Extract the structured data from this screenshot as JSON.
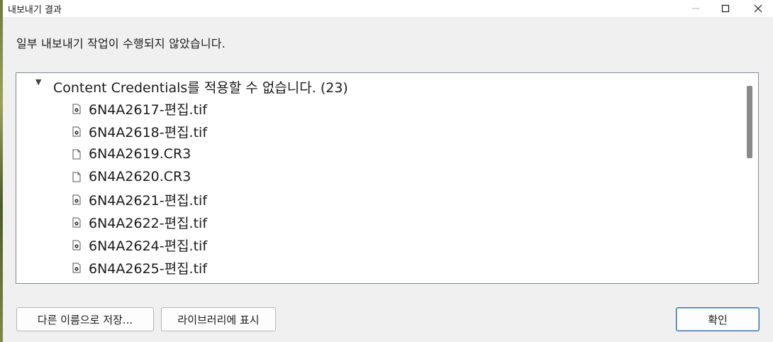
{
  "window": {
    "title": "내보내기 결과",
    "controls": {
      "minimize": "—",
      "maximize": "☐",
      "close": "✕"
    }
  },
  "message": "일부 내보내기 작업이 수행되지 않았습니다.",
  "results": {
    "group_label": "Content Credentials를 적용할 수 없습니다. (23)",
    "files": [
      {
        "name": "6N4A2617-편집.tif",
        "icon": "image-file-icon"
      },
      {
        "name": "6N4A2618-편집.tif",
        "icon": "image-file-icon"
      },
      {
        "name": "6N4A2619.CR3",
        "icon": "blank-file-icon"
      },
      {
        "name": "6N4A2620.CR3",
        "icon": "blank-file-icon"
      },
      {
        "name": "6N4A2621-편집.tif",
        "icon": "image-file-icon"
      },
      {
        "name": "6N4A2622-편집.tif",
        "icon": "image-file-icon"
      },
      {
        "name": "6N4A2624-편집.tif",
        "icon": "image-file-icon"
      },
      {
        "name": "6N4A2625-편집.tif",
        "icon": "image-file-icon"
      }
    ]
  },
  "buttons": {
    "save_as": "다른 이름으로 저장...",
    "show_in_library": "라이브러리에 표시",
    "ok": "확인"
  }
}
